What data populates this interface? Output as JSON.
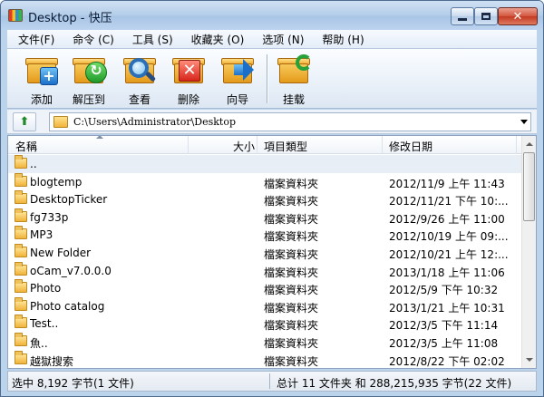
{
  "window": {
    "title": "Desktop - 快压"
  },
  "menu": [
    "文件(F)",
    "命令 (C)",
    "工具 (S)",
    "收藏夹 (O)",
    "选项 (N)",
    "帮助 (H)"
  ],
  "toolbar": {
    "add": "添加",
    "extract": "解压到",
    "view": "查看",
    "delete": "删除",
    "wizard": "向导",
    "mount": "挂载"
  },
  "address": {
    "path": "C:\\Users\\Administrator\\Desktop"
  },
  "columns": {
    "name": "名稱",
    "size": "大小",
    "type": "項目類型",
    "date": "修改日期"
  },
  "files": [
    {
      "name": "..",
      "type": "",
      "date": ""
    },
    {
      "name": "blogtemp",
      "type": "檔案資料夾",
      "date": "2012/11/9 上午 11:43"
    },
    {
      "name": "DesktopTicker",
      "type": "檔案資料夾",
      "date": "2012/11/21 下午 10:..."
    },
    {
      "name": "fg733p",
      "type": "檔案資料夾",
      "date": "2012/9/26 上午 11:00"
    },
    {
      "name": "MP3",
      "type": "檔案資料夾",
      "date": "2012/10/19 上午 09:..."
    },
    {
      "name": "New Folder",
      "type": "檔案資料夾",
      "date": "2012/10/21 上午 12:..."
    },
    {
      "name": "oCam_v7.0.0.0",
      "type": "檔案資料夾",
      "date": "2013/1/18 上午 11:06"
    },
    {
      "name": "Photo",
      "type": "檔案資料夾",
      "date": "2012/5/9 下午 10:32"
    },
    {
      "name": "Photo catalog",
      "type": "檔案資料夾",
      "date": "2013/1/21 上午 10:31"
    },
    {
      "name": "Test..",
      "type": "檔案資料夾",
      "date": "2012/3/5 下午 11:14"
    },
    {
      "name": "魚..",
      "type": "檔案資料夾",
      "date": "2012/3/5 上午 11:08"
    },
    {
      "name": "越獄搜索",
      "type": "檔案資料夾",
      "date": "2012/8/22 下午 02:02"
    }
  ],
  "status": {
    "left": "选中  8,192 字节(1 文件)",
    "right": "总计 11 文件夹  和  288,215,935 字节(22 文件)"
  }
}
